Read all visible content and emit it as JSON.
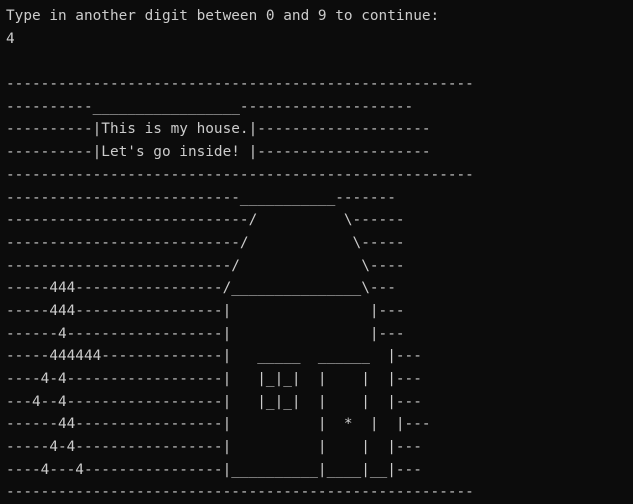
{
  "terminal": {
    "lines": [
      "Type in another digit between 0 and 9 to continue:",
      "4",
      "",
      "------------------------------------------------------",
      "----------_________________--------------------",
      "----------|This is my house.|--------------------",
      "----------|Let's go inside! |--------------------",
      "------------------------------------------------------",
      "---------------------------___________-------",
      "----------------------------/          \\------",
      "---------------------------/            \\-----",
      "--------------------------/              \\----",
      "-----444-----------------/_______________\\---",
      "-----444-----------------|                |---",
      "------4------------------|                |---",
      "-----444444--------------|   _____  ______  |---",
      "----4-4------------------|   |_|_|  |    |  |---",
      "---4--4------------------|   |_|_|  |    |  |---",
      "------44-----------------|          |  *  |  |---",
      "-----4-4-----------------|          |    |  |---",
      "----4---4----------------|__________|____|__|---",
      "------------------------------------------------------"
    ]
  }
}
